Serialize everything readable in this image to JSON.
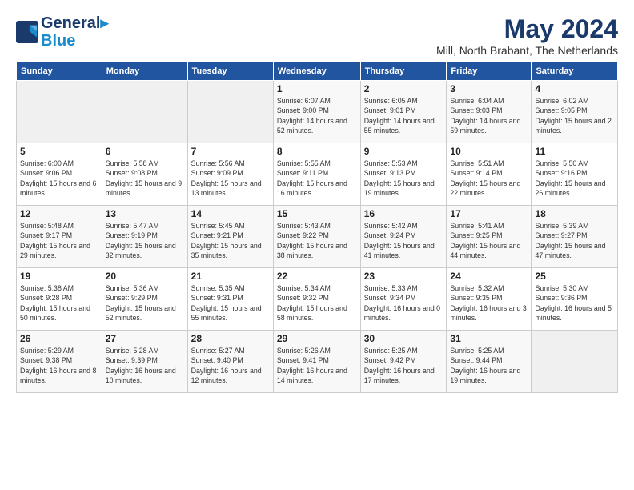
{
  "header": {
    "logo_line1": "General",
    "logo_line2": "Blue",
    "month": "May 2024",
    "location": "Mill, North Brabant, The Netherlands"
  },
  "weekdays": [
    "Sunday",
    "Monday",
    "Tuesday",
    "Wednesday",
    "Thursday",
    "Friday",
    "Saturday"
  ],
  "weeks": [
    [
      {
        "day": "",
        "detail": ""
      },
      {
        "day": "",
        "detail": ""
      },
      {
        "day": "",
        "detail": ""
      },
      {
        "day": "1",
        "detail": "Sunrise: 6:07 AM\nSunset: 9:00 PM\nDaylight: 14 hours and 52 minutes."
      },
      {
        "day": "2",
        "detail": "Sunrise: 6:05 AM\nSunset: 9:01 PM\nDaylight: 14 hours and 55 minutes."
      },
      {
        "day": "3",
        "detail": "Sunrise: 6:04 AM\nSunset: 9:03 PM\nDaylight: 14 hours and 59 minutes."
      },
      {
        "day": "4",
        "detail": "Sunrise: 6:02 AM\nSunset: 9:05 PM\nDaylight: 15 hours and 2 minutes."
      }
    ],
    [
      {
        "day": "5",
        "detail": "Sunrise: 6:00 AM\nSunset: 9:06 PM\nDaylight: 15 hours and 6 minutes."
      },
      {
        "day": "6",
        "detail": "Sunrise: 5:58 AM\nSunset: 9:08 PM\nDaylight: 15 hours and 9 minutes."
      },
      {
        "day": "7",
        "detail": "Sunrise: 5:56 AM\nSunset: 9:09 PM\nDaylight: 15 hours and 13 minutes."
      },
      {
        "day": "8",
        "detail": "Sunrise: 5:55 AM\nSunset: 9:11 PM\nDaylight: 15 hours and 16 minutes."
      },
      {
        "day": "9",
        "detail": "Sunrise: 5:53 AM\nSunset: 9:13 PM\nDaylight: 15 hours and 19 minutes."
      },
      {
        "day": "10",
        "detail": "Sunrise: 5:51 AM\nSunset: 9:14 PM\nDaylight: 15 hours and 22 minutes."
      },
      {
        "day": "11",
        "detail": "Sunrise: 5:50 AM\nSunset: 9:16 PM\nDaylight: 15 hours and 26 minutes."
      }
    ],
    [
      {
        "day": "12",
        "detail": "Sunrise: 5:48 AM\nSunset: 9:17 PM\nDaylight: 15 hours and 29 minutes."
      },
      {
        "day": "13",
        "detail": "Sunrise: 5:47 AM\nSunset: 9:19 PM\nDaylight: 15 hours and 32 minutes."
      },
      {
        "day": "14",
        "detail": "Sunrise: 5:45 AM\nSunset: 9:21 PM\nDaylight: 15 hours and 35 minutes."
      },
      {
        "day": "15",
        "detail": "Sunrise: 5:43 AM\nSunset: 9:22 PM\nDaylight: 15 hours and 38 minutes."
      },
      {
        "day": "16",
        "detail": "Sunrise: 5:42 AM\nSunset: 9:24 PM\nDaylight: 15 hours and 41 minutes."
      },
      {
        "day": "17",
        "detail": "Sunrise: 5:41 AM\nSunset: 9:25 PM\nDaylight: 15 hours and 44 minutes."
      },
      {
        "day": "18",
        "detail": "Sunrise: 5:39 AM\nSunset: 9:27 PM\nDaylight: 15 hours and 47 minutes."
      }
    ],
    [
      {
        "day": "19",
        "detail": "Sunrise: 5:38 AM\nSunset: 9:28 PM\nDaylight: 15 hours and 50 minutes."
      },
      {
        "day": "20",
        "detail": "Sunrise: 5:36 AM\nSunset: 9:29 PM\nDaylight: 15 hours and 52 minutes."
      },
      {
        "day": "21",
        "detail": "Sunrise: 5:35 AM\nSunset: 9:31 PM\nDaylight: 15 hours and 55 minutes."
      },
      {
        "day": "22",
        "detail": "Sunrise: 5:34 AM\nSunset: 9:32 PM\nDaylight: 15 hours and 58 minutes."
      },
      {
        "day": "23",
        "detail": "Sunrise: 5:33 AM\nSunset: 9:34 PM\nDaylight: 16 hours and 0 minutes."
      },
      {
        "day": "24",
        "detail": "Sunrise: 5:32 AM\nSunset: 9:35 PM\nDaylight: 16 hours and 3 minutes."
      },
      {
        "day": "25",
        "detail": "Sunrise: 5:30 AM\nSunset: 9:36 PM\nDaylight: 16 hours and 5 minutes."
      }
    ],
    [
      {
        "day": "26",
        "detail": "Sunrise: 5:29 AM\nSunset: 9:38 PM\nDaylight: 16 hours and 8 minutes."
      },
      {
        "day": "27",
        "detail": "Sunrise: 5:28 AM\nSunset: 9:39 PM\nDaylight: 16 hours and 10 minutes."
      },
      {
        "day": "28",
        "detail": "Sunrise: 5:27 AM\nSunset: 9:40 PM\nDaylight: 16 hours and 12 minutes."
      },
      {
        "day": "29",
        "detail": "Sunrise: 5:26 AM\nSunset: 9:41 PM\nDaylight: 16 hours and 14 minutes."
      },
      {
        "day": "30",
        "detail": "Sunrise: 5:25 AM\nSunset: 9:42 PM\nDaylight: 16 hours and 17 minutes."
      },
      {
        "day": "31",
        "detail": "Sunrise: 5:25 AM\nSunset: 9:44 PM\nDaylight: 16 hours and 19 minutes."
      },
      {
        "day": "",
        "detail": ""
      }
    ]
  ]
}
